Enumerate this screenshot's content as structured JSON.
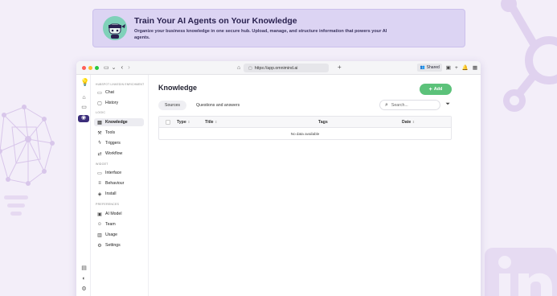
{
  "banner": {
    "title": "Train Your AI Agents on Your Knowledge",
    "subtitle": "Organize your business knowledge in one secure hub. Upload, manage, and structure information that powers your AI agents."
  },
  "browser": {
    "url": "https://app.omnimind.ai",
    "shared_label": "Shared",
    "colors": {
      "close": "#ff5f57",
      "minimize": "#febc2e",
      "maximize": "#28c840"
    }
  },
  "sidebar": {
    "workspace": "HUBSPOT LINKEDIN ENRICHMENT",
    "top_items": [
      {
        "label": "Chat",
        "icon": "chat-bubble-icon"
      },
      {
        "label": "History",
        "icon": "history-icon"
      }
    ],
    "logic": {
      "title": "LOGIC",
      "items": [
        {
          "label": "Knowledge",
          "icon": "book-icon"
        },
        {
          "label": "Tools",
          "icon": "wrench-icon"
        },
        {
          "label": "Triggers",
          "icon": "lightning-icon"
        },
        {
          "label": "Workflow",
          "icon": "flow-icon"
        }
      ]
    },
    "widget": {
      "title": "WIDGET",
      "items": [
        {
          "label": "Interface",
          "icon": "window-icon"
        },
        {
          "label": "Behaviour",
          "icon": "sliders-icon"
        },
        {
          "label": "Install",
          "icon": "cube-icon"
        }
      ]
    },
    "preferences": {
      "title": "PREFERENCES",
      "items": [
        {
          "label": "AI Model",
          "icon": "chip-icon"
        },
        {
          "label": "Team",
          "icon": "team-icon"
        },
        {
          "label": "Usage",
          "icon": "chart-icon"
        },
        {
          "label": "Settings",
          "icon": "gear-icon"
        }
      ]
    }
  },
  "main": {
    "title": "Knowledge",
    "add_label": "Add",
    "tabs": [
      "Sources",
      "Questions and answers"
    ],
    "search_placeholder": "Search...",
    "columns": [
      "Type",
      "Title",
      "Tags",
      "Date"
    ],
    "empty_text": "No data available"
  },
  "accent": "#5cc27a"
}
